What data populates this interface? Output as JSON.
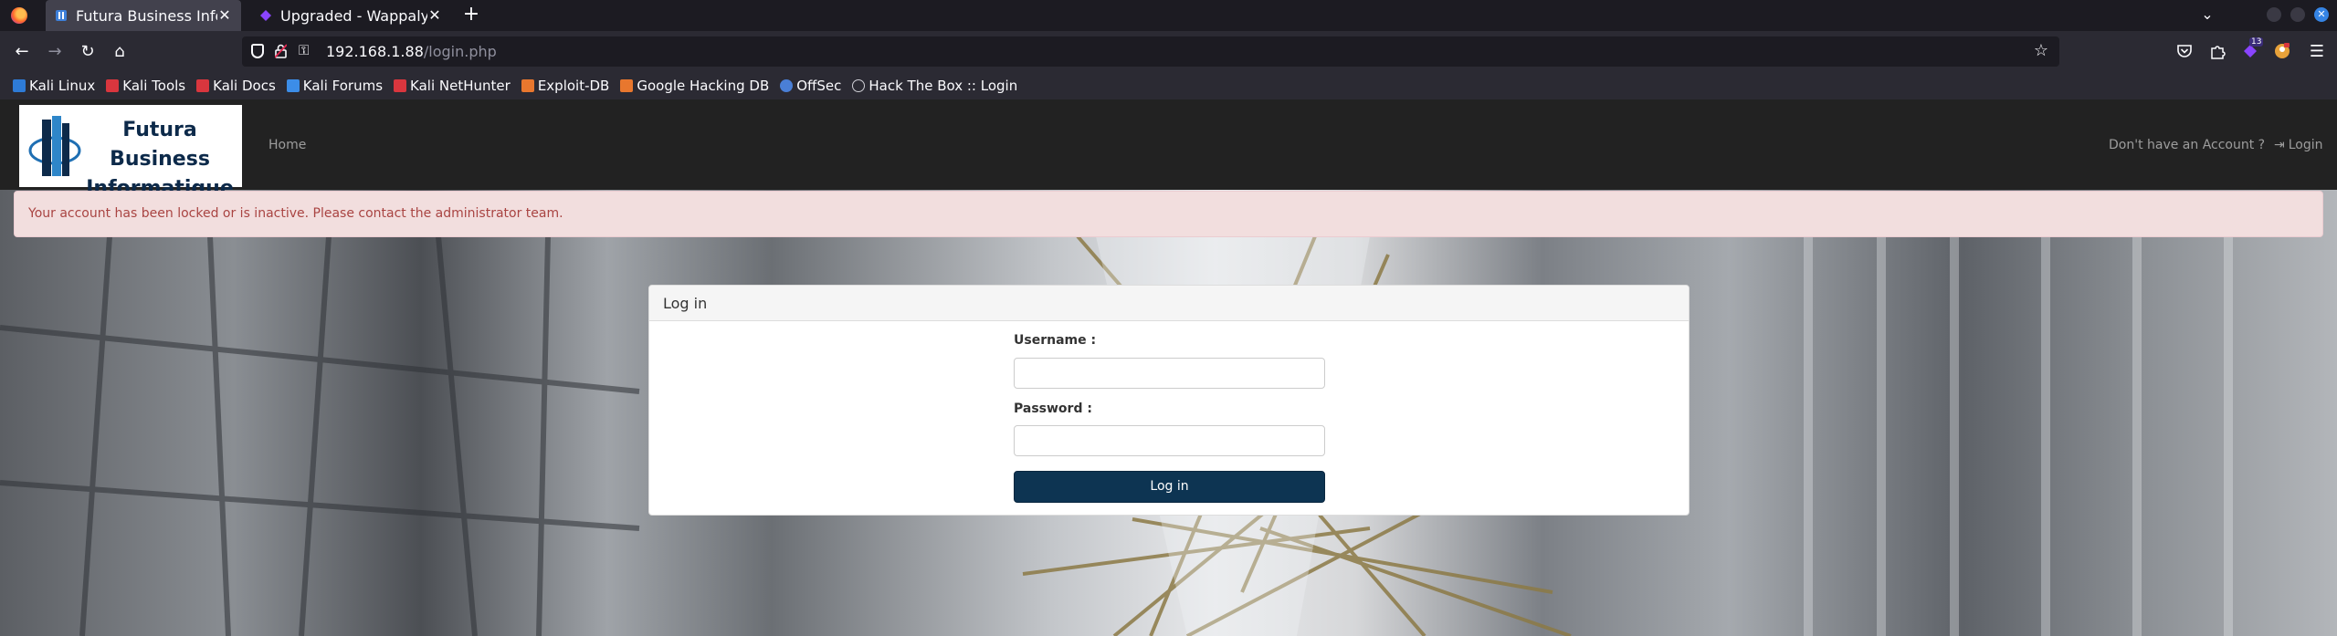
{
  "browser": {
    "tabs": [
      {
        "title": "Futura Business Informat",
        "active": true
      },
      {
        "title": "Upgraded - Wappalyzer",
        "active": false
      }
    ],
    "new_tab": "+",
    "list_tabs": "⌄",
    "url_host": "192.168.1.88",
    "url_path": "/login.php",
    "extension_badge": "13",
    "bookmarks": [
      {
        "label": "Kali Linux",
        "color": "#2e7bd6"
      },
      {
        "label": "Kali Tools",
        "color": "#d9363e"
      },
      {
        "label": "Kali Docs",
        "color": "#d9363e"
      },
      {
        "label": "Kali Forums",
        "color": "#3c8de8"
      },
      {
        "label": "Kali NetHunter",
        "color": "#d9363e"
      },
      {
        "label": "Exploit-DB",
        "color": "#e8772e"
      },
      {
        "label": "Google Hacking DB",
        "color": "#e8772e"
      },
      {
        "label": "OffSec",
        "color": "#4a7fd6"
      },
      {
        "label": "Hack The Box :: Login",
        "color": "#cfcfd6"
      }
    ]
  },
  "site": {
    "brand_line1": "Futura Business",
    "brand_line2": "Informatique",
    "nav_home": "Home",
    "nav_signup": "Don't have an Account ?",
    "nav_login": "Login",
    "alert_text": "Your account has been locked or is inactive. Please contact the administrator team.",
    "panel_title": "Log in",
    "username_label": "Username :",
    "username_value": "",
    "password_label": "Password :",
    "password_value": "",
    "submit_label": "Log in"
  },
  "colors": {
    "header_bg": "#222222",
    "alert_bg": "#f2dede",
    "alert_text": "#a94442",
    "submit_bg": "#0d3452"
  }
}
